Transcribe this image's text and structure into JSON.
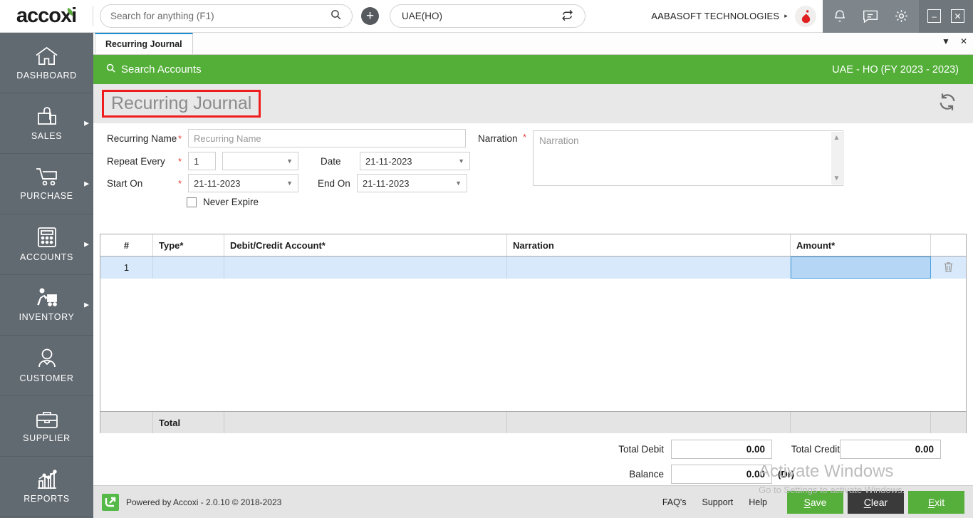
{
  "header": {
    "logo_text": "accoxi",
    "search": {
      "placeholder": "Search for anything (F1)",
      "value": ""
    },
    "add_icon": "plus-icon",
    "branch": {
      "value": "UAE(HO)",
      "switch_icon": "switch-branch-icon"
    },
    "company": "AABASOFT TECHNOLOGIES",
    "company_caret": "▸",
    "icons": [
      "bell-icon",
      "message-icon",
      "gear-icon"
    ],
    "window_minimize": "–",
    "window_close": "✕"
  },
  "sidebar": {
    "items": [
      {
        "label": "DASHBOARD",
        "icon": "home-icon",
        "has_arrow": false
      },
      {
        "label": "SALES",
        "icon": "shopping-bag-icon",
        "has_arrow": true
      },
      {
        "label": "PURCHASE",
        "icon": "shopping-cart-icon",
        "has_arrow": true
      },
      {
        "label": "ACCOUNTS",
        "icon": "calculator-icon",
        "has_arrow": true
      },
      {
        "label": "INVENTORY",
        "icon": "warehouse-worker-icon",
        "has_arrow": true
      },
      {
        "label": "CUSTOMER",
        "icon": "person-icon",
        "has_arrow": false
      },
      {
        "label": "SUPPLIER",
        "icon": "briefcase-icon",
        "has_arrow": false
      },
      {
        "label": "REPORTS",
        "icon": "bar-chart-icon",
        "has_arrow": false
      }
    ]
  },
  "tabs": {
    "active": "Recurring Journal",
    "dropdown_icon": "chevron-down-icon",
    "close_icon": "close-icon"
  },
  "greenbar": {
    "search_accounts": "Search Accounts",
    "search_icon": "search-icon",
    "fiscal_info": "UAE - HO (FY 2023 - 2023)"
  },
  "page": {
    "title": "Recurring Journal",
    "refresh_icon": "refresh-icon",
    "highlight_color": "#ef1d1d"
  },
  "form": {
    "recurring_name": {
      "label": "Recurring Name",
      "required": "*",
      "placeholder": "Recurring Name",
      "value": ""
    },
    "repeat_every": {
      "label": "Repeat Every",
      "required": "*",
      "count": "1",
      "unit": ""
    },
    "start_on": {
      "label": "Start On",
      "required": "*",
      "value": "21-11-2023"
    },
    "date": {
      "label": "Date",
      "value": "21-11-2023"
    },
    "end_on": {
      "label": "End On",
      "value": "21-11-2023"
    },
    "never_expire": {
      "label": "Never Expire",
      "checked": false
    },
    "narration": {
      "label": "Narration",
      "required": "*",
      "placeholder": "Narration",
      "value": ""
    }
  },
  "grid": {
    "columns": [
      "#",
      "Type*",
      "Debit/Credit Account*",
      "Narration",
      "Amount*",
      ""
    ],
    "rows": [
      {
        "num": "1",
        "type": "",
        "account": "",
        "narration": "",
        "amount": "",
        "delete_icon": "trash-icon"
      }
    ],
    "total_label": "Total",
    "total_values": [
      "",
      "",
      ""
    ]
  },
  "totals": {
    "total_debit_label": "Total Debit",
    "total_debit_value": "0.00",
    "total_credit_label": "Total Credit",
    "total_credit_value": "0.00",
    "balance_label": "Balance",
    "balance_value": "0.00",
    "balance_type": "(Dr)"
  },
  "footer": {
    "powered_by": "Powered by Accoxi - 2.0.10 © 2018-2023",
    "links": [
      "FAQ's",
      "Support",
      "Help"
    ],
    "buttons": [
      {
        "label": "Save",
        "accel": "S",
        "style": "green"
      },
      {
        "label": "Clear",
        "accel": "C",
        "style": "dark"
      },
      {
        "label": "Exit",
        "accel": "E",
        "style": "green"
      }
    ]
  },
  "watermark": {
    "line1": "Activate Windows",
    "line2": "Go to Settings to activate Windows."
  }
}
